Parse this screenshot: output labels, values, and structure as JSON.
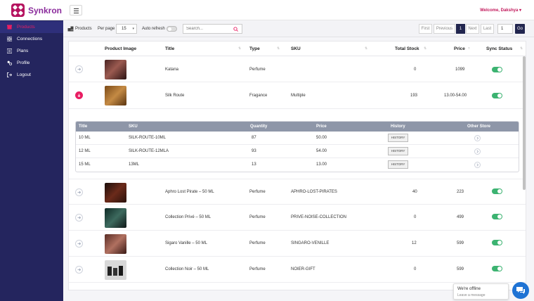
{
  "brand": {
    "name": "Synkron",
    "logo_color": "#b5135f"
  },
  "header": {
    "welcome": "Welcome, Dakshya",
    "menu_icon": "hamburger-icon"
  },
  "sidebar": {
    "items": [
      {
        "label": "Products",
        "icon": "box-icon",
        "active": true
      },
      {
        "label": "Connections",
        "icon": "grid-icon",
        "active": false
      },
      {
        "label": "Plans",
        "icon": "list-icon",
        "active": false
      },
      {
        "label": "Profile",
        "icon": "profile-icon",
        "active": false
      },
      {
        "label": "Logout",
        "icon": "logout-icon",
        "active": false
      }
    ]
  },
  "toolbar": {
    "section": "Products",
    "per_page_label": "Per page",
    "per_page_value": "15",
    "auto_refresh_label": "Auto refresh",
    "auto_refresh_on": false,
    "search_placeholder": "Search...",
    "pagination": {
      "first": "First",
      "previous": "Previous",
      "current": "1",
      "next": "Next",
      "last": "Last",
      "page_input": "1",
      "go": "Go"
    }
  },
  "table": {
    "headers": {
      "image": "Product Image",
      "title": "Title",
      "type": "Type",
      "sku": "SKU",
      "stock": "Total Stock",
      "price": "Price",
      "sync": "Sync Status"
    },
    "rows": [
      {
        "title": "Katana",
        "type": "Perfume",
        "sku": "",
        "stock": "0",
        "price": "1099",
        "synced": true
      },
      {
        "title": "Silk Route",
        "type": "Fragance",
        "sku": "Multiple",
        "stock": "193",
        "price": "13.00-54.00",
        "synced": true,
        "expanded": true
      },
      {
        "title": "Aphro Lost Pirate – 50 ML",
        "type": "Perfume",
        "sku": "APHRO-LOST-PIRATES",
        "stock": "40",
        "price": "223",
        "synced": true
      },
      {
        "title": "Collection Privé – 50 ML",
        "type": "Perfume",
        "sku": "PRIVE-NOISE-COLLECTION",
        "stock": "0",
        "price": "499",
        "synced": true
      },
      {
        "title": "Sigaro Vanille – 50 ML",
        "type": "Perfume",
        "sku": "SINGARO-VENILLE",
        "stock": "12",
        "price": "599",
        "synced": true
      },
      {
        "title": "Collection Noir – 50 ML",
        "type": "Perfume",
        "sku": "NOIER-GIFT",
        "stock": "0",
        "price": "599",
        "synced": true
      }
    ]
  },
  "variants": {
    "headers": {
      "title": "Title",
      "sku": "SKU",
      "quantity": "Quantity",
      "price": "Price",
      "history": "History",
      "other_store": "Other Store"
    },
    "rows": [
      {
        "title": "10 ML",
        "sku": "SILK-ROUTE-10ML",
        "quantity": "87",
        "price": "50.00",
        "history": "HISTORY"
      },
      {
        "title": "12 ML",
        "sku": "SILK-ROUTE-12MLA",
        "quantity": "93",
        "price": "54.00",
        "history": "HISTORY"
      },
      {
        "title": "15 ML",
        "sku": "13ML",
        "quantity": "13",
        "price": "13.00",
        "history": "HISTORY"
      }
    ]
  },
  "chat": {
    "status": "We're offline",
    "action": "Leave a message"
  },
  "colors": {
    "sidebar": "#24255e",
    "accent": "#e91e63",
    "sync_on": "#3cb371",
    "primary_dark": "#22264f"
  }
}
